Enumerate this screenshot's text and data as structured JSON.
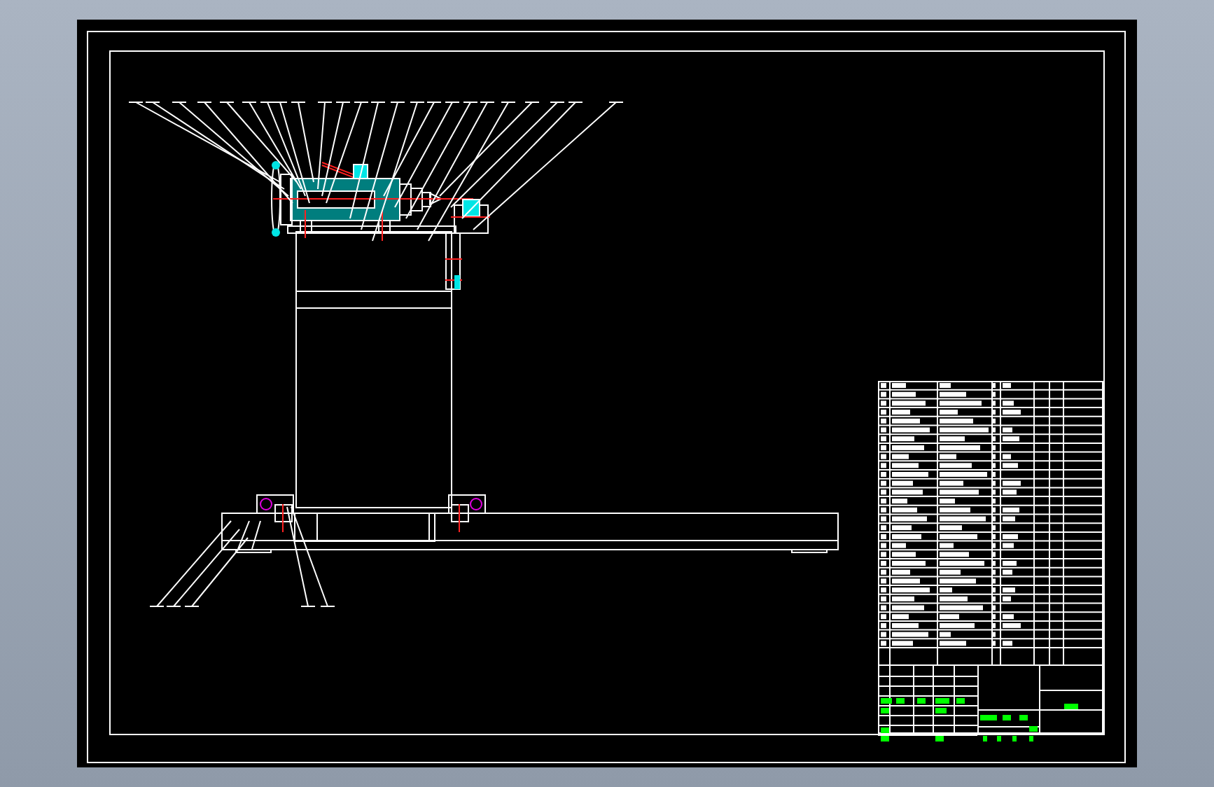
{
  "sheet": {
    "kind": "assembly"
  },
  "views": [
    {
      "kind": "front-section"
    }
  ],
  "parts_list": {
    "rows": [
      {
        "kind": "item"
      },
      {
        "kind": "item"
      },
      {
        "kind": "item"
      },
      {
        "kind": "item"
      },
      {
        "kind": "item"
      },
      {
        "kind": "item"
      },
      {
        "kind": "item"
      },
      {
        "kind": "item"
      },
      {
        "kind": "item"
      },
      {
        "kind": "item"
      },
      {
        "kind": "item"
      },
      {
        "kind": "item"
      },
      {
        "kind": "item"
      },
      {
        "kind": "item"
      },
      {
        "kind": "item"
      },
      {
        "kind": "item"
      },
      {
        "kind": "item"
      },
      {
        "kind": "item"
      },
      {
        "kind": "item"
      },
      {
        "kind": "item"
      },
      {
        "kind": "item"
      },
      {
        "kind": "item"
      },
      {
        "kind": "item"
      },
      {
        "kind": "item"
      },
      {
        "kind": "item"
      },
      {
        "kind": "item"
      },
      {
        "kind": "item"
      },
      {
        "kind": "item"
      },
      {
        "kind": "item"
      },
      {
        "kind": "item"
      }
    ]
  },
  "title_block": {
    "kind": "standard"
  }
}
